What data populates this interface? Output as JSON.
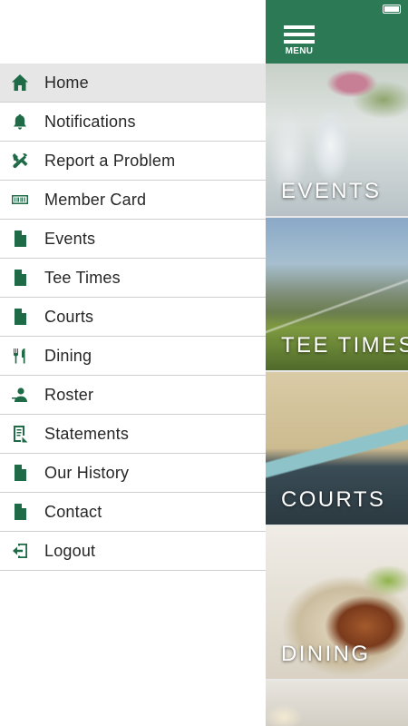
{
  "drawer": {
    "items": [
      {
        "label": "Home",
        "icon": "home-icon",
        "active": true
      },
      {
        "label": "Notifications",
        "icon": "bell-icon",
        "active": false
      },
      {
        "label": "Report a Problem",
        "icon": "tools-icon",
        "active": false
      },
      {
        "label": "Member Card",
        "icon": "barcode-icon",
        "active": false
      },
      {
        "label": "Events",
        "icon": "document-icon",
        "active": false
      },
      {
        "label": "Tee Times",
        "icon": "document-icon",
        "active": false
      },
      {
        "label": "Courts",
        "icon": "document-icon",
        "active": false
      },
      {
        "label": "Dining",
        "icon": "fork-knife-icon",
        "active": false
      },
      {
        "label": "Roster",
        "icon": "person-icon",
        "active": false
      },
      {
        "label": "Statements",
        "icon": "statement-icon",
        "active": false
      },
      {
        "label": "Our History",
        "icon": "document-icon",
        "active": false
      },
      {
        "label": "Contact",
        "icon": "document-icon",
        "active": false
      },
      {
        "label": "Logout",
        "icon": "logout-icon",
        "active": false
      }
    ]
  },
  "header": {
    "menu_label": "MENU"
  },
  "tiles": [
    {
      "label": "EVENTS"
    },
    {
      "label": "TEE TIMES"
    },
    {
      "label": "COURTS"
    },
    {
      "label": "DINING"
    }
  ],
  "colors": {
    "brand_green": "#2c7a55",
    "icon_green": "#1f6b47",
    "active_row": "#e6e6e6"
  }
}
